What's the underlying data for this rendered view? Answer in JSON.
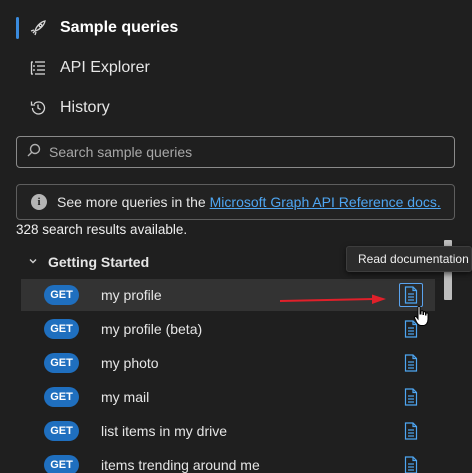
{
  "nav": {
    "items": [
      {
        "label": "Sample queries",
        "icon": "rocket-icon",
        "active": true
      },
      {
        "label": "API Explorer",
        "icon": "list-tree-icon",
        "active": false
      },
      {
        "label": "History",
        "icon": "history-icon",
        "active": false
      }
    ]
  },
  "search": {
    "placeholder": "Search sample queries",
    "value": ""
  },
  "info": {
    "text": "See more queries in the",
    "link_text": "Microsoft Graph API Reference docs."
  },
  "results": {
    "count_text": "328 search results available."
  },
  "group": {
    "label": "Getting Started",
    "expanded": true
  },
  "tooltip": {
    "text": "Read documentation"
  },
  "queries": [
    {
      "method": "GET",
      "label": "my profile"
    },
    {
      "method": "GET",
      "label": "my profile (beta)"
    },
    {
      "method": "GET",
      "label": "my photo"
    },
    {
      "method": "GET",
      "label": "my mail"
    },
    {
      "method": "GET",
      "label": "list items in my drive"
    },
    {
      "method": "GET",
      "label": "items trending around me"
    }
  ],
  "colors": {
    "accent": "#3a8bde",
    "badge": "#1f6fbf",
    "link": "#4ea6f2",
    "annotation_arrow": "#e0202a"
  }
}
